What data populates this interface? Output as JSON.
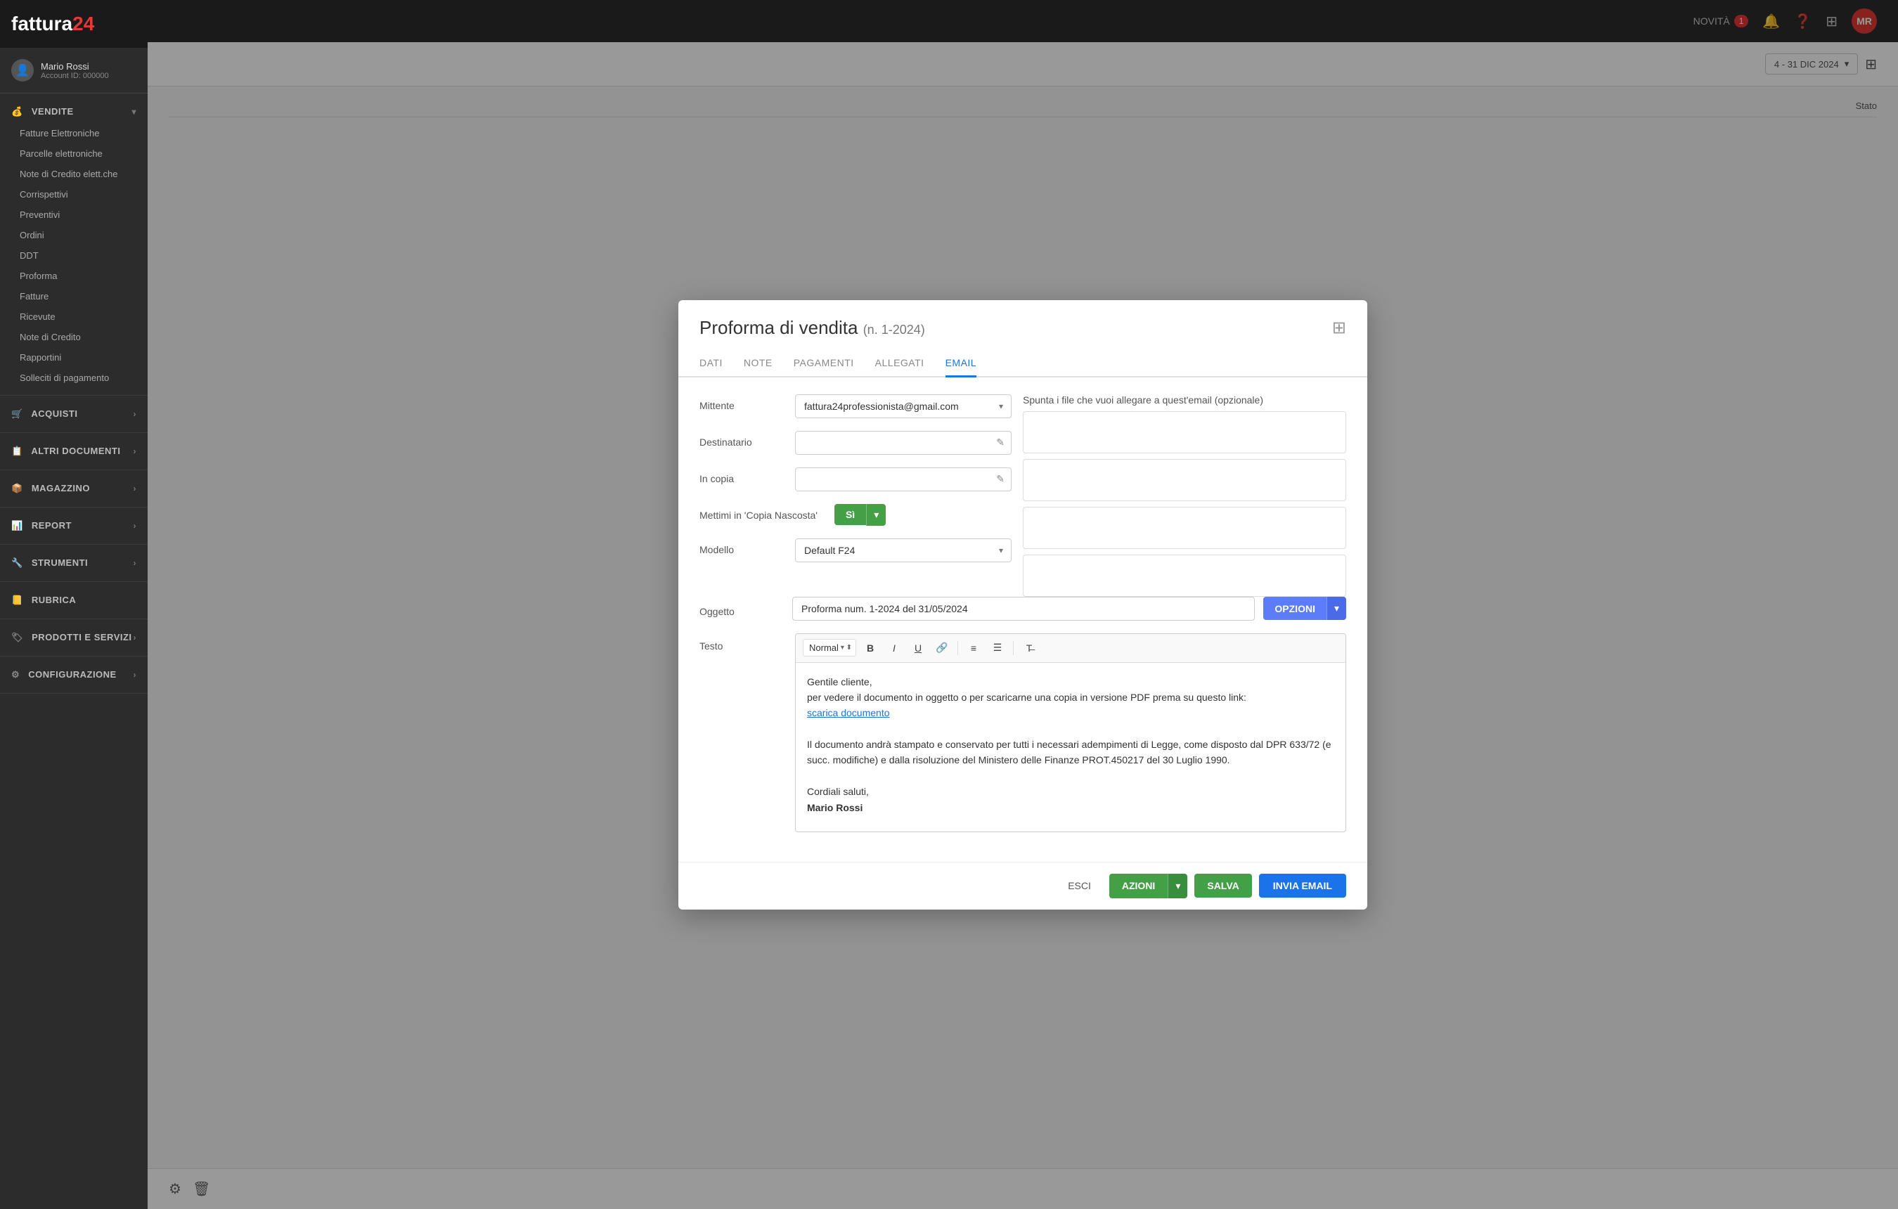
{
  "app": {
    "logo": "fattura",
    "logo_number": "24",
    "topbar": {
      "novita_label": "NOVITÀ",
      "novita_count": "1",
      "avatar_initials": "MR"
    }
  },
  "sidebar": {
    "user": {
      "name": "Mario Rossi",
      "account_id": "Account ID: 000000"
    },
    "sections": [
      {
        "id": "vendite",
        "label": "VENDITE",
        "expanded": true,
        "items": [
          "Fatture Elettroniche",
          "Parcelle elettroniche",
          "Note di Credito elett.che",
          "Corrispettivi",
          "Preventivi",
          "Ordini",
          "DDT",
          "Proforma",
          "Fatture",
          "Ricevute",
          "Note di Credito",
          "Rapportini",
          "Solleciti di pagamento"
        ]
      },
      {
        "id": "acquisti",
        "label": "ACQUISTI",
        "expanded": false,
        "items": []
      },
      {
        "id": "altri-documenti",
        "label": "ALTRI DOCUMENTI",
        "expanded": false,
        "items": []
      },
      {
        "id": "magazzino",
        "label": "MAGAZZINO",
        "expanded": false,
        "items": []
      },
      {
        "id": "report",
        "label": "REPORT",
        "expanded": false,
        "items": []
      },
      {
        "id": "strumenti",
        "label": "STRUMENTI",
        "expanded": false,
        "items": []
      },
      {
        "id": "rubrica",
        "label": "RUBRICA",
        "expanded": false,
        "items": []
      },
      {
        "id": "prodotti-servizi",
        "label": "PRODOTTI E SERVIZI",
        "expanded": false,
        "items": []
      },
      {
        "id": "configurazione",
        "label": "CONFIGURAZIONE",
        "expanded": false,
        "items": []
      }
    ]
  },
  "content": {
    "date_filter": "4 - 31 DIC 2024",
    "table": {
      "stato_column": "Stato"
    }
  },
  "modal": {
    "title": "Proforma di vendita",
    "subtitle": "(n. 1-2024)",
    "tabs": [
      "DATI",
      "NOTE",
      "PAGAMENTI",
      "ALLEGATI",
      "EMAIL"
    ],
    "active_tab": "EMAIL",
    "email": {
      "mittente_label": "Mittente",
      "mittente_value": "fattura24professionista@gmail.com",
      "destinatario_label": "Destinatario",
      "in_copia_label": "In copia",
      "copia_nascosta_label": "Mettimi in 'Copia Nascosta'",
      "copia_nascosta_value": "Sì",
      "modello_label": "Modello",
      "modello_value": "Default F24",
      "oggetto_label": "Oggetto",
      "oggetto_value": "Proforma num. 1-2024 del 31/05/2024",
      "opzioni_label": "OPZIONI",
      "testo_label": "Testo",
      "attachments_label": "Spunta i file che vuoi allegare a quest'email (opzionale)",
      "toolbar": {
        "format_label": "Normal",
        "bold": "B",
        "italic": "I",
        "underline": "U"
      },
      "body_line1": "Gentile cliente,",
      "body_line2": "per vedere il documento in oggetto o per scaricarne una copia in versione PDF prema su questo link:",
      "body_link": "scarica documento",
      "body_line3": "Il documento andrà stampato e conservato per tutti i necessari adempimenti di Legge, come disposto dal DPR 633/72 (e succ. modifiche) e dalla risoluzione del Ministero delle Finanze PROT.450217 del 30 Luglio 1990.",
      "body_saluti": "Cordiali saluti,",
      "body_firma": "Mario Rossi"
    },
    "footer": {
      "esci_label": "ESCI",
      "azioni_label": "AZIONI",
      "salva_label": "SALVA",
      "invia_label": "INVIA EMAIL"
    }
  },
  "bottom_bar": {
    "settings_icon": "⚙",
    "trash_icon": "🗑"
  }
}
